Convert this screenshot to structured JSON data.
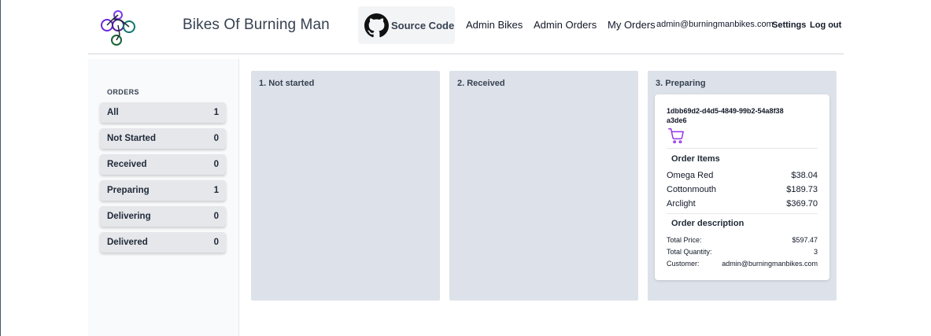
{
  "header": {
    "site_title": "Bikes Of Burning Man",
    "source_code_label": "Source Code",
    "nav": {
      "admin_bikes": "Admin Bikes",
      "admin_orders": "Admin Orders",
      "my_orders": "My Orders",
      "user_email": "admin@burningmanbikes.com",
      "settings": "Settings",
      "logout": "Log out"
    }
  },
  "sidebar": {
    "title": "ORDERS",
    "filters": [
      {
        "label": "All",
        "count": "1"
      },
      {
        "label": "Not Started",
        "count": "0"
      },
      {
        "label": "Received",
        "count": "0"
      },
      {
        "label": "Preparing",
        "count": "1"
      },
      {
        "label": "Delivering",
        "count": "0"
      },
      {
        "label": "Delivered",
        "count": "0"
      }
    ]
  },
  "columns": [
    {
      "title": "1. Not started"
    },
    {
      "title": "2. Received"
    },
    {
      "title": "3. Preparing"
    }
  ],
  "order_card": {
    "id": "1dbb69d2-d4d5-4849-99b2-54a8f38a3de6",
    "items_title": "Order Items",
    "items": [
      {
        "name": "Omega Red",
        "price": "$38.04"
      },
      {
        "name": "Cottonmouth",
        "price": "$189.73"
      },
      {
        "name": "Arclight",
        "price": "$369.70"
      }
    ],
    "description_title": "Order description",
    "total_price_label": "Total Price:",
    "total_price": "$597.47",
    "total_quantity_label": "Total Quantity:",
    "total_quantity": "3",
    "customer_label": "Customer:",
    "customer": "admin@burningmanbikes.com"
  },
  "colors": {
    "column_bg": "#dde2ea",
    "filter_bg": "#e5e7eb",
    "cart_icon": "#9333ea"
  }
}
